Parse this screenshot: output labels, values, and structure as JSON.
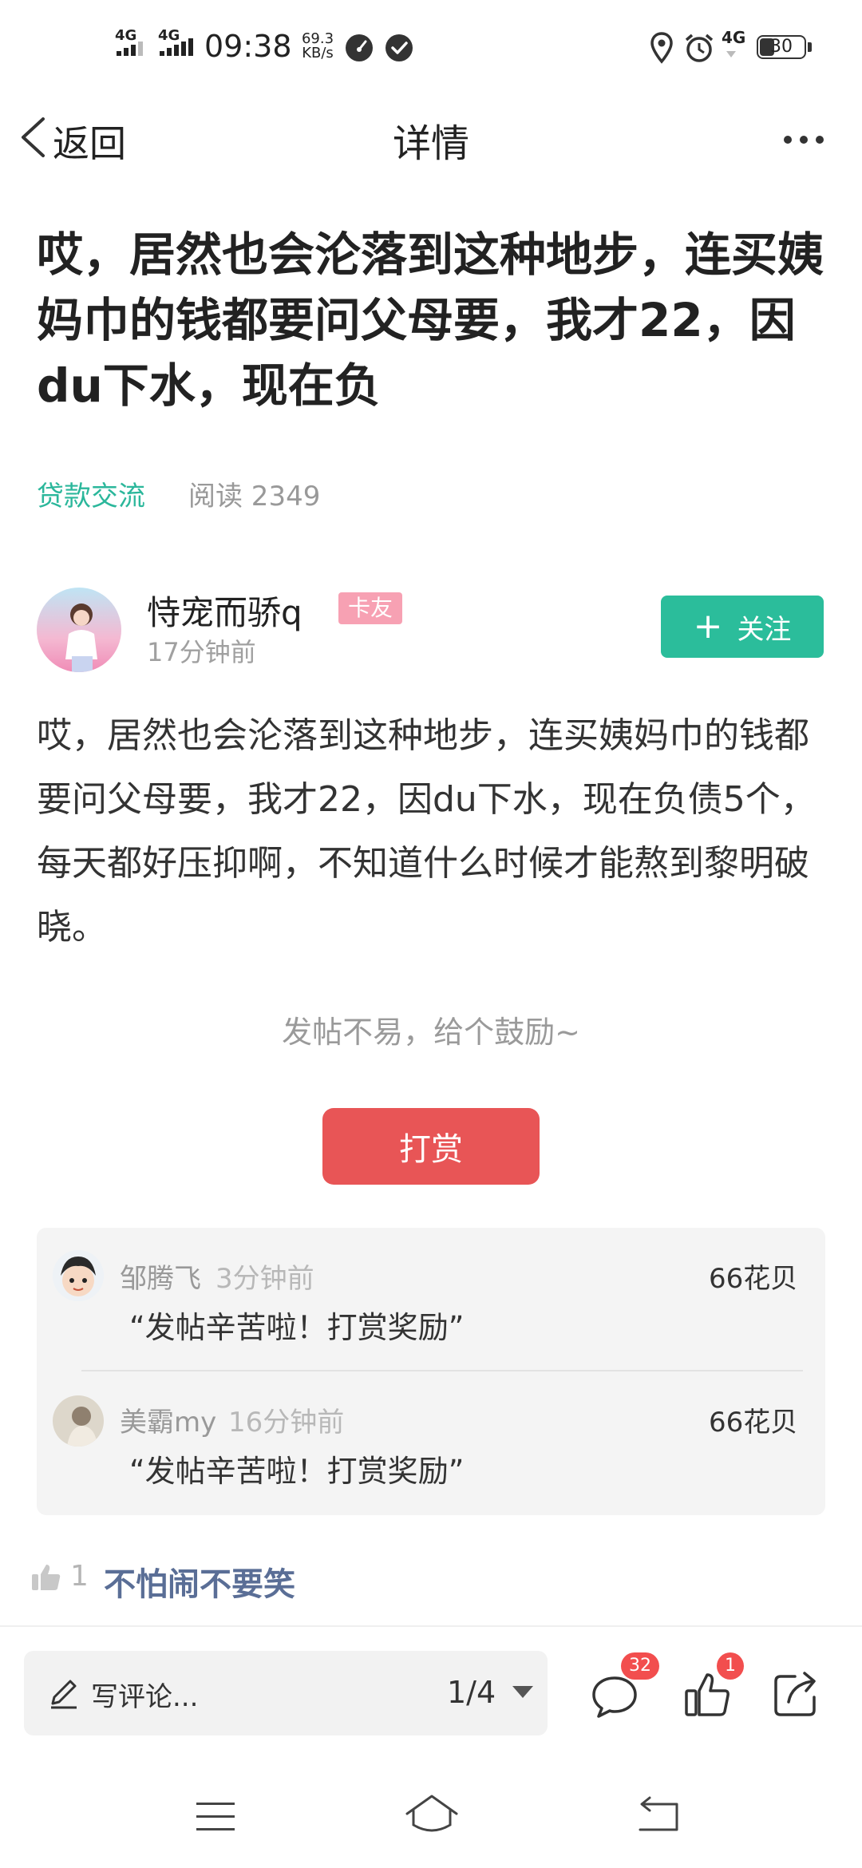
{
  "status_bar": {
    "network_1": "4G",
    "network_2": "4G",
    "time": "09:38",
    "speed_value": "69.3",
    "speed_unit": "KB/s",
    "network_3": "4G",
    "battery": "30"
  },
  "nav": {
    "back_label": "返回",
    "title": "详情"
  },
  "post": {
    "title": "哎，居然也会沦落到这种地步，连买姨妈巾的钱都要问父母要，我才22，因du下水，现在负",
    "category": "贷款交流",
    "read_label": "阅读 2349",
    "author": {
      "name": "恃宠而骄q",
      "badge": "卡友",
      "time": "17分钟前"
    },
    "follow_label": "关注",
    "body": "哎，居然也会沦落到这种地步，连买姨妈巾的钱都要问父母要，我才22，因du下水，现在负债5个，每天都好压抑啊，不知道什么时候才能熬到黎明破晓。",
    "encourage": "发帖不易，给个鼓励~",
    "tip_button": "打赏"
  },
  "tips": [
    {
      "name": "邹腾飞",
      "time": "3分钟前",
      "amount": "66花贝",
      "message": "“发帖辛苦啦！打赏奖励”"
    },
    {
      "name": "美霸my",
      "time": "16分钟前",
      "amount": "66花贝",
      "message": "“发帖辛苦啦！打赏奖励”"
    }
  ],
  "likes": {
    "count": "1",
    "user": "不怕闹不要笑"
  },
  "bottom_bar": {
    "comment_placeholder": "写评论...",
    "page_indicator": "1/4",
    "comment_count": "32",
    "like_count": "1"
  },
  "colors": {
    "accent_green": "#2bbd9b",
    "tip_red": "#e85556",
    "badge_red": "#f24e4e"
  }
}
